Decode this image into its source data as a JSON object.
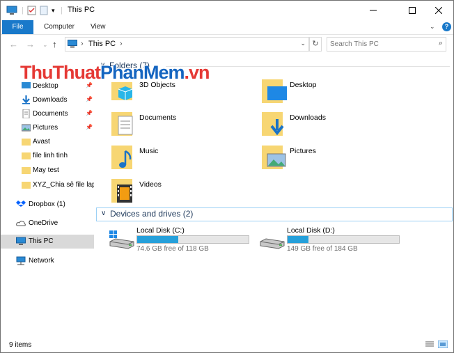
{
  "window": {
    "title": "This PC"
  },
  "ribbon": {
    "tabs": [
      "File",
      "Computer",
      "View"
    ]
  },
  "address": {
    "crumb": "This PC",
    "search_placeholder": "Search This PC"
  },
  "sidebar": {
    "items": [
      {
        "label": "Desktop"
      },
      {
        "label": "Downloads"
      },
      {
        "label": "Documents"
      },
      {
        "label": "Pictures"
      },
      {
        "label": "Avast"
      },
      {
        "label": "file linh tinh"
      },
      {
        "label": "May test"
      },
      {
        "label": "XYZ_Chia sẻ file lapt"
      },
      {
        "label": "Dropbox (1)"
      },
      {
        "label": "OneDrive"
      },
      {
        "label": "This PC"
      },
      {
        "label": "Network"
      }
    ]
  },
  "folders": {
    "header": "Folders (7)",
    "items": [
      {
        "name": "3D Objects"
      },
      {
        "name": "Desktop"
      },
      {
        "name": "Documents"
      },
      {
        "name": "Downloads"
      },
      {
        "name": "Music"
      },
      {
        "name": "Pictures"
      },
      {
        "name": "Videos"
      }
    ]
  },
  "devices": {
    "header": "Devices and drives (2)",
    "drives": [
      {
        "name": "Local Disk (C:)",
        "free_text": "74.6 GB free of 118 GB",
        "used_fraction": 0.368
      },
      {
        "name": "Local Disk (D:)",
        "free_text": "149 GB free of 184 GB",
        "used_fraction": 0.19
      }
    ]
  },
  "status": {
    "items": "9 items"
  },
  "watermark": {
    "part1": "ThuThuat",
    "part2": "PhanMem",
    "part3": ".vn"
  },
  "colors": {
    "accent": "#1979ca",
    "drive_fill": "#26a0da",
    "folder": "#f7d673"
  }
}
